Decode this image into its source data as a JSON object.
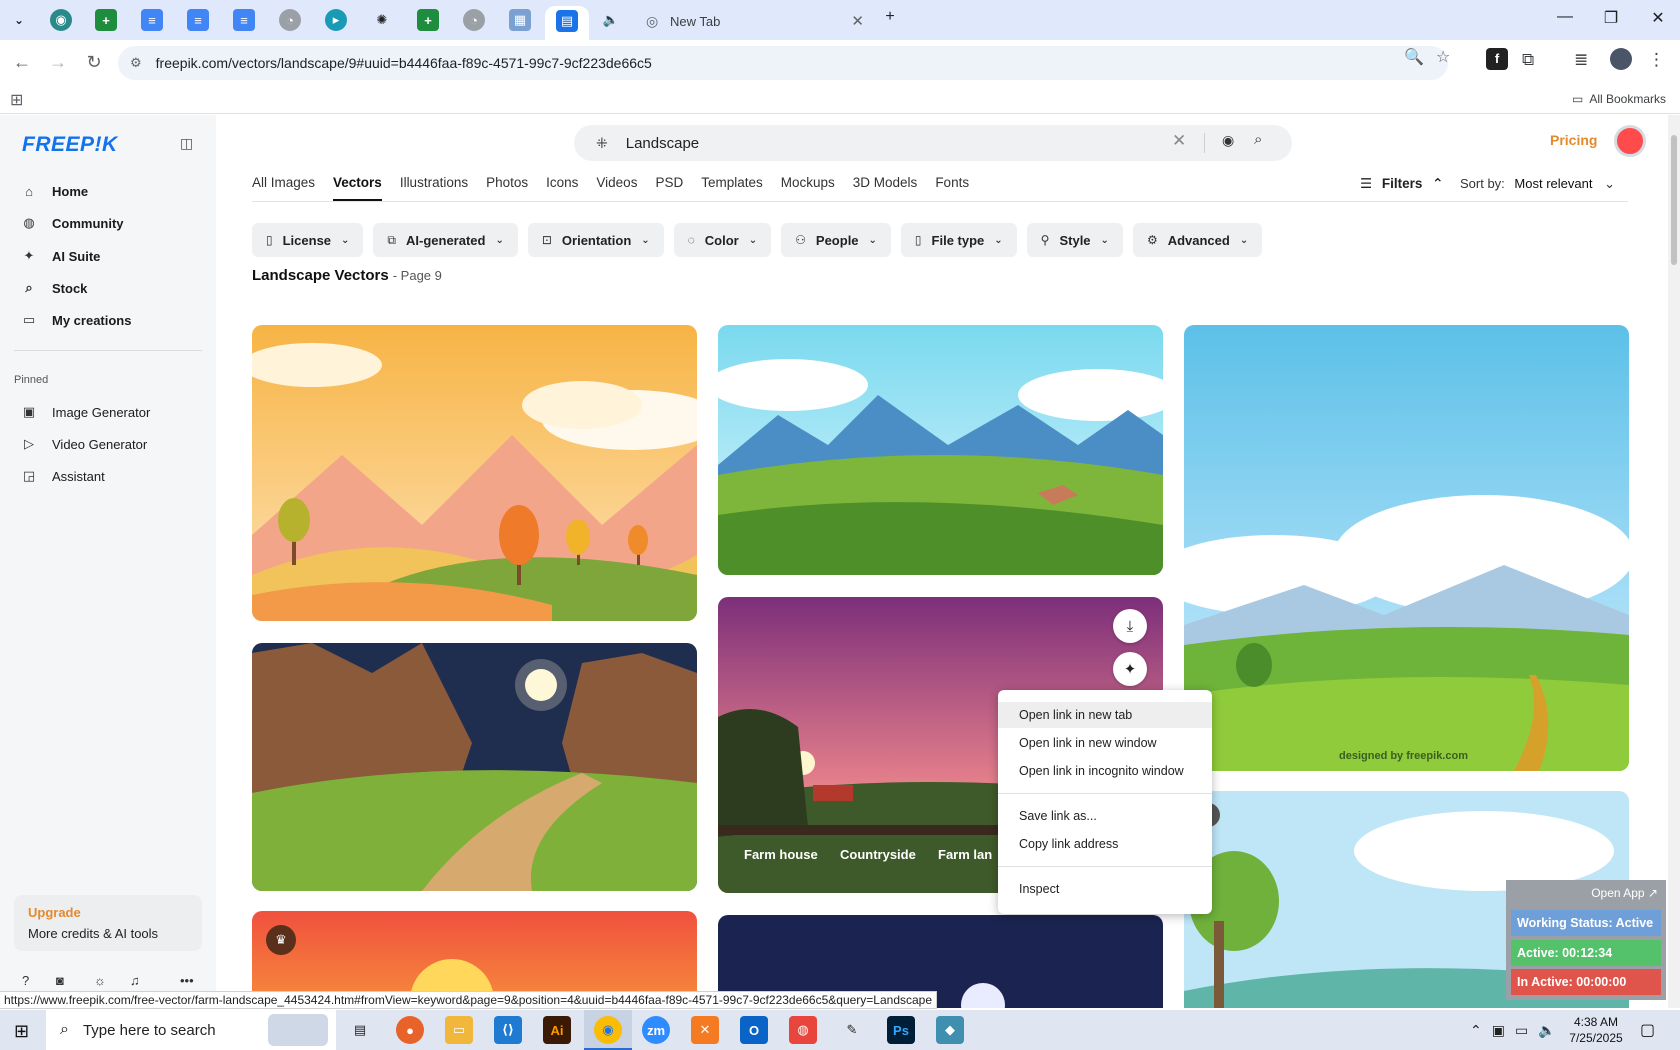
{
  "browser": {
    "active_tab_title": "New Tab",
    "url": "freepik.com/vectors/landscape/9#uuid=b4446faa-f89c-4571-99c7-9cf223de66c5",
    "all_bookmarks": "All Bookmarks",
    "status_url": "https://www.freepik.com/free-vector/farm-landscape_4453424.htm#fromView=keyword&page=9&position=4&uuid=b4446faa-f89c-4571-99c7-9cf223de66c5&query=Landscape"
  },
  "sidebar": {
    "logo": "FREEP!K",
    "items": [
      {
        "label": "Home",
        "icon": "home-icon"
      },
      {
        "label": "Community",
        "icon": "globe-icon"
      },
      {
        "label": "AI Suite",
        "icon": "sparkle-icon"
      },
      {
        "label": "Stock",
        "icon": "search-icon"
      },
      {
        "label": "My creations",
        "icon": "folder-icon"
      }
    ],
    "pinned_label": "Pinned",
    "pinned": [
      {
        "label": "Image Generator",
        "icon": "image-icon"
      },
      {
        "label": "Video Generator",
        "icon": "video-icon"
      },
      {
        "label": "Assistant",
        "icon": "chat-icon"
      }
    ],
    "upgrade_title": "Upgrade",
    "upgrade_sub": "More credits & AI tools"
  },
  "search": {
    "query": "Landscape"
  },
  "header": {
    "pricing": "Pricing"
  },
  "type_tabs": [
    "All Images",
    "Vectors",
    "Illustrations",
    "Photos",
    "Icons",
    "Videos",
    "PSD",
    "Templates",
    "Mockups",
    "3D Models",
    "Fonts"
  ],
  "active_type_tab": "Vectors",
  "filters_label": "Filters",
  "sort_label": "Sort by:",
  "sort_value": "Most relevant",
  "chips": [
    {
      "label": "License",
      "icon": "license-icon"
    },
    {
      "label": "AI-generated",
      "icon": "ai-icon"
    },
    {
      "label": "Orientation",
      "icon": "orientation-icon"
    },
    {
      "label": "Color",
      "icon": "palette-icon"
    },
    {
      "label": "People",
      "icon": "people-icon"
    },
    {
      "label": "File type",
      "icon": "file-icon"
    },
    {
      "label": "Style",
      "icon": "brush-icon"
    },
    {
      "label": "Advanced",
      "icon": "gear-icon"
    }
  ],
  "results": {
    "title": "Landscape Vectors",
    "page": "- Page 9"
  },
  "card_tags": [
    "Farm house",
    "Countryside",
    "Farm lan"
  ],
  "watermark": "designed by freepik.com",
  "context_menu": [
    "Open link in new tab",
    "Open link in new window",
    "Open link in incognito window",
    "Save link as...",
    "Copy link address",
    "Inspect"
  ],
  "work_widget": {
    "open_app": "Open App ↗",
    "status": "Working Status: Active",
    "active": "Active: 00:12:34",
    "inactive": "In Active: 00:00:00",
    "colors": {
      "status": "#6f9fd8",
      "active": "#53c26b",
      "inactive": "#e0554b"
    }
  },
  "taskbar": {
    "search_placeholder": "Type here to search",
    "time": "4:38 AM",
    "date": "7/25/2025"
  },
  "colors": {
    "accent": "#1273eb",
    "pricing": "#e58a2b"
  }
}
